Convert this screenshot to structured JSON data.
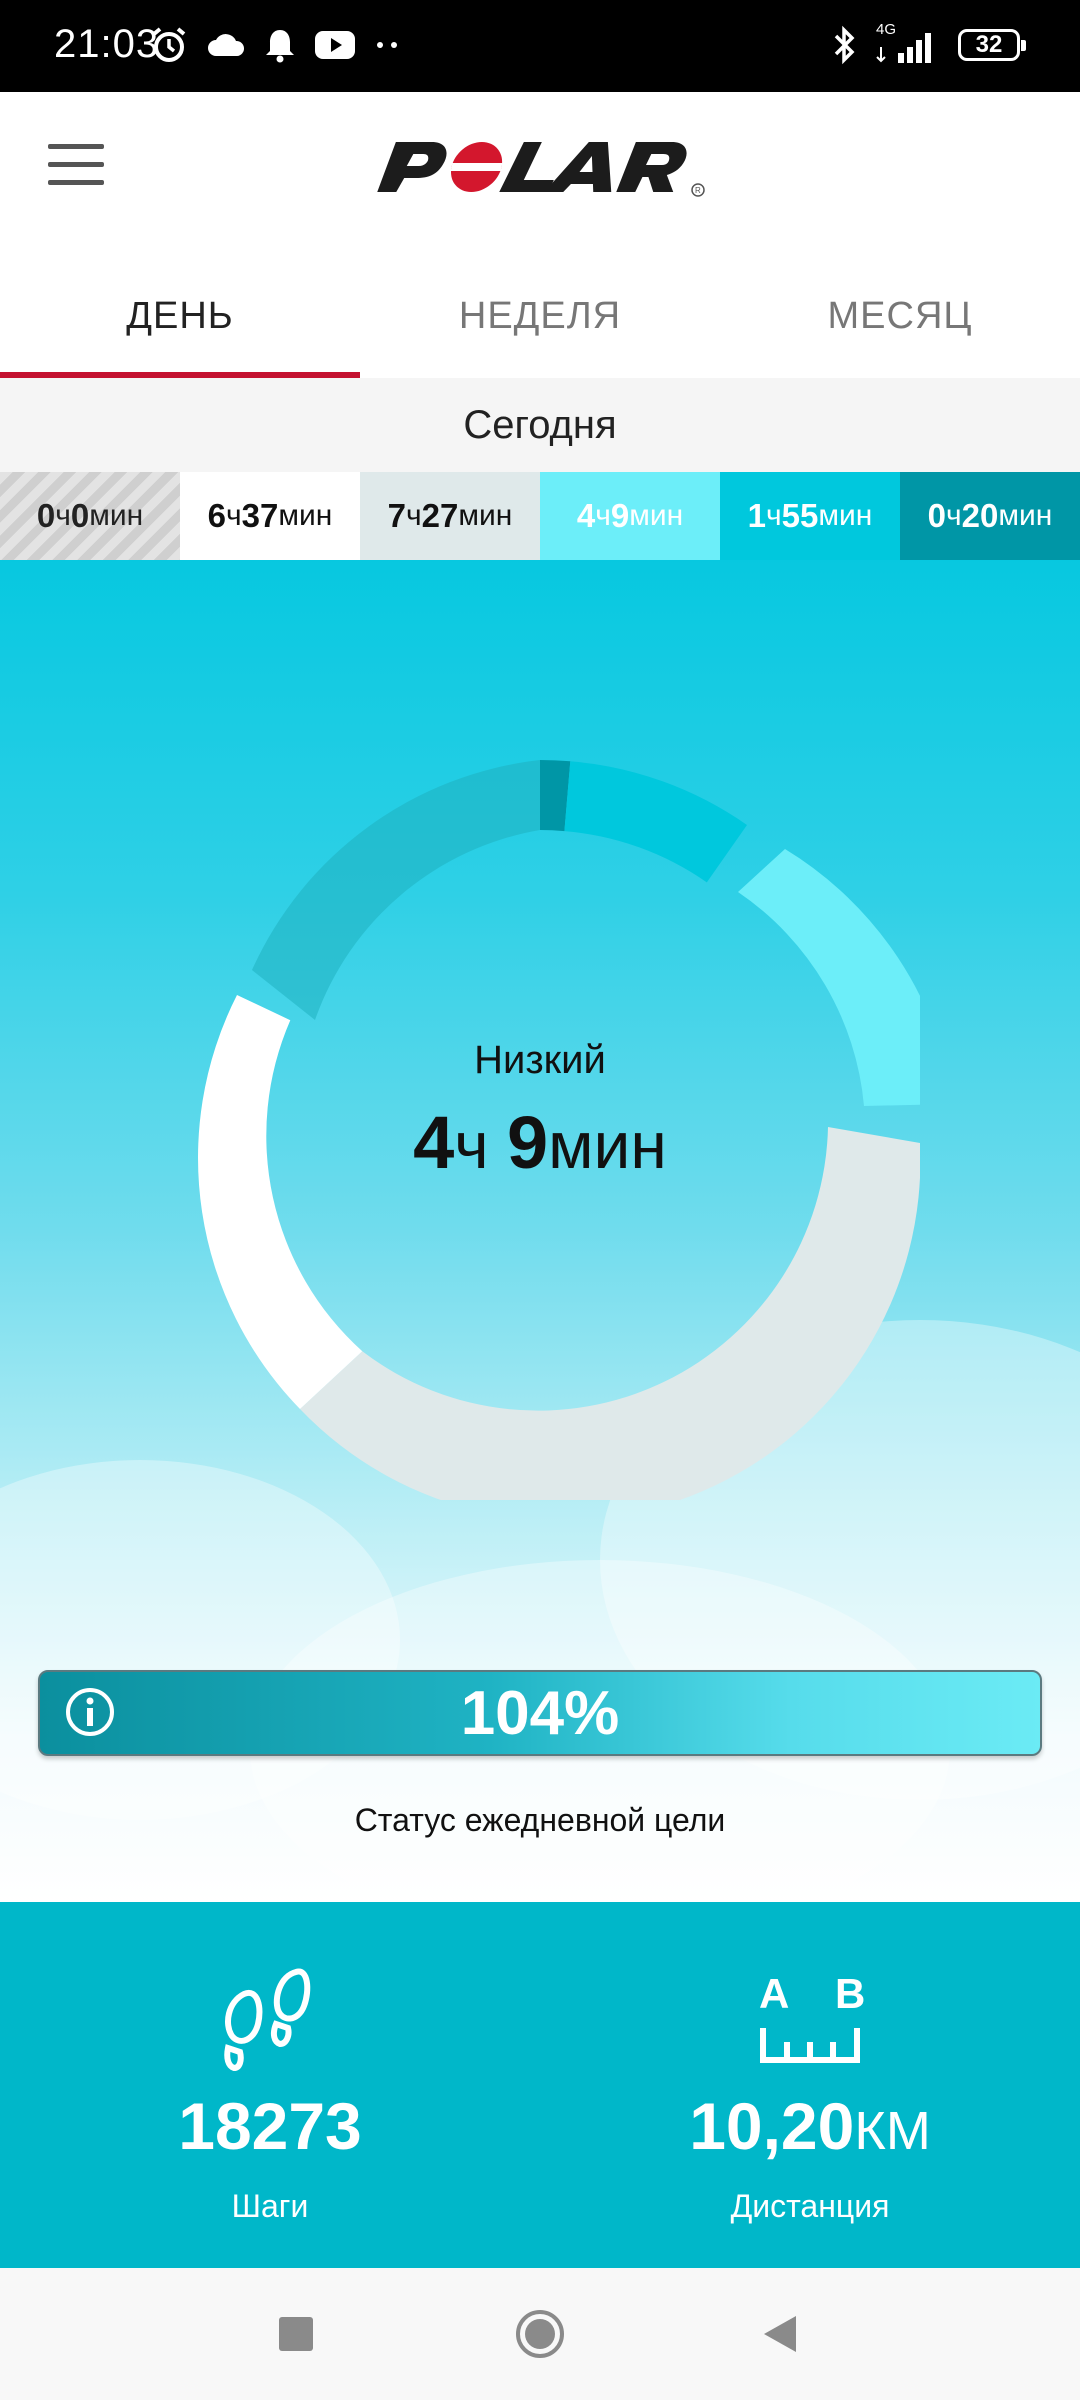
{
  "status_bar": {
    "time": "21:03",
    "network": "4G",
    "battery": "32"
  },
  "header": {
    "logo": "POLAR"
  },
  "tabs": [
    {
      "label": "ДЕНЬ",
      "active": true
    },
    {
      "label": "НЕДЕЛЯ",
      "active": false
    },
    {
      "label": "МЕСЯЦ",
      "active": false
    }
  ],
  "date_label": "Сегодня",
  "zones": [
    {
      "h": "0",
      "h_unit": "ч",
      "m": "0",
      "m_unit": "мин"
    },
    {
      "h": "6",
      "h_unit": "ч",
      "m": "37",
      "m_unit": "мин"
    },
    {
      "h": "7",
      "h_unit": "ч",
      "m": "27",
      "m_unit": "мин"
    },
    {
      "h": "4",
      "h_unit": "ч",
      "m": "9",
      "m_unit": "мин"
    },
    {
      "h": "1",
      "h_unit": "ч",
      "m": "55",
      "m_unit": "мин"
    },
    {
      "h": "0",
      "h_unit": "ч",
      "m": "20",
      "m_unit": "мин"
    }
  ],
  "selected_zone": {
    "name": "Низкий",
    "h": "4",
    "h_unit": "ч",
    "m": "9",
    "m_unit": "мин"
  },
  "goal": {
    "percent": "104%",
    "label": "Статус ежедневной цели"
  },
  "stats": {
    "steps": {
      "value": "18273",
      "label": "Шаги"
    },
    "distance": {
      "value": "10,20",
      "unit": "КМ",
      "label": "Дистанция",
      "icon_a": "A",
      "icon_b": "B"
    }
  },
  "colors": {
    "accent": "#c41230",
    "zone_rest": "#d9d9d9",
    "zone_sitting": "#ffffff",
    "zone_low": "#6ceef9",
    "zone_medium": "#00c8dd",
    "zone_high": "#0096a6",
    "zone_light": "#dfe9ea"
  }
}
